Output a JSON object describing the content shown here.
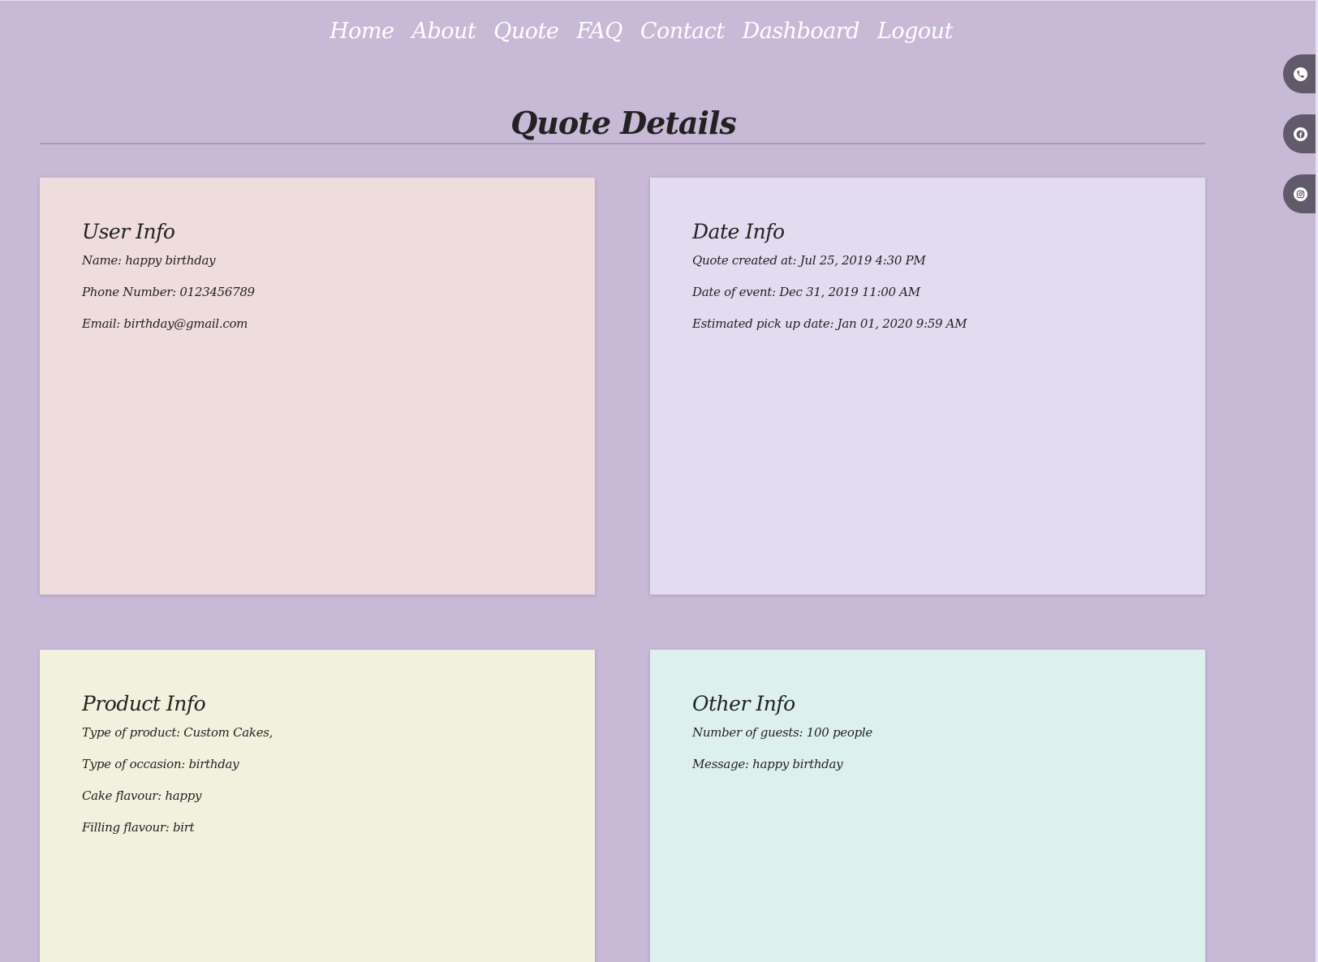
{
  "nav": {
    "items": [
      "Home",
      "About",
      "Quote",
      "FAQ",
      "Contact",
      "Dashboard",
      "Logout"
    ]
  },
  "page": {
    "title": "Quote Details"
  },
  "cards": {
    "user": {
      "title": "User Info",
      "lines": [
        "Name: happy birthday",
        "Phone Number: 0123456789",
        "Email: birthday@gmail.com"
      ]
    },
    "date": {
      "title": "Date Info",
      "lines": [
        "Quote created at: Jul 25, 2019 4:30 PM",
        "Date of event: Dec 31, 2019 11:00 AM",
        "Estimated pick up date: Jan 01, 2020 9:59 AM"
      ]
    },
    "product": {
      "title": "Product Info",
      "lines": [
        "Type of product: Custom Cakes,",
        "Type of occasion: birthday",
        "Cake flavour: happy",
        "Filling flavour: birt"
      ]
    },
    "other": {
      "title": "Other Info",
      "lines": [
        "Number of guests: 100 people",
        "Message: happy birthday"
      ]
    }
  },
  "social": {
    "icons": [
      "phone-icon",
      "facebook-icon",
      "instagram-icon"
    ]
  },
  "colors": {
    "background": "#c8b9d7",
    "user_card": "#efdcdc",
    "date_card": "#e3dcf0",
    "product_card": "#f1f1dd",
    "other_card": "#dcf1ee",
    "social_tab": "#615a6b"
  }
}
